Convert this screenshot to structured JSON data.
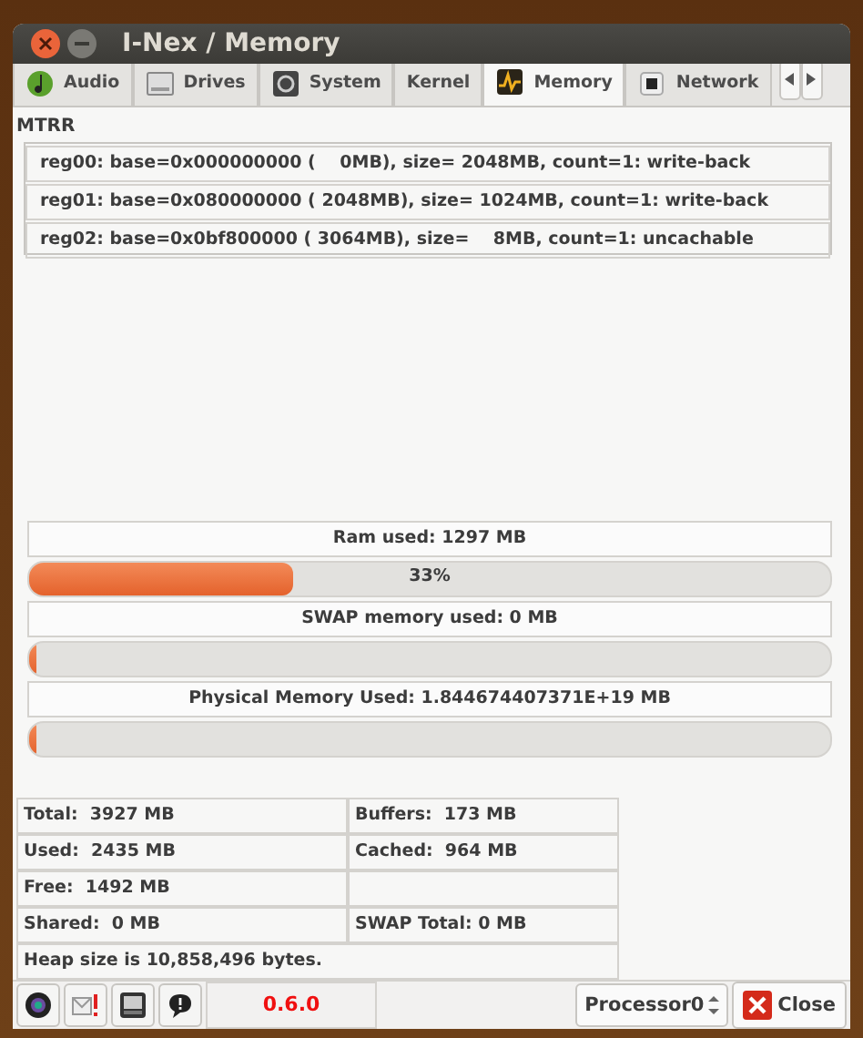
{
  "window": {
    "title": "I-Nex / Memory"
  },
  "tabs": [
    {
      "label": "Audio",
      "selected": false
    },
    {
      "label": "Drives",
      "selected": false
    },
    {
      "label": "System",
      "selected": false
    },
    {
      "label": "Kernel",
      "selected": false
    },
    {
      "label": "Memory",
      "selected": true
    },
    {
      "label": "Network",
      "selected": false
    }
  ],
  "mtrr": {
    "title": "MTRR",
    "rows": [
      "reg00: base=0x000000000 (    0MB), size= 2048MB, count=1: write-back",
      "reg01: base=0x080000000 ( 2048MB), size= 1024MB, count=1: write-back",
      "reg02: base=0x0bf800000 ( 3064MB), size=    8MB, count=1: uncachable"
    ]
  },
  "meters": [
    {
      "label": "Ram used: 1297 MB",
      "level": 0.33,
      "reading": "33%"
    },
    {
      "label": "SWAP memory used: 0 MB",
      "level": 0.01
    },
    {
      "label": "Physical Memory Used: 1.844674407371E+19 MB",
      "level": 0.01
    }
  ],
  "stats": [
    {
      "left": "Total:  3927 MB",
      "right": "Buffers:  173 MB"
    },
    {
      "left": "Used:  2435 MB",
      "right": "Cached:  964 MB"
    },
    {
      "left": "Free:  1492 MB"
    },
    {
      "left": "Shared:  0 MB",
      "right": "SWAP Total: 0 MB"
    }
  ],
  "heap": "Heap size is 10,858,496 bytes.",
  "footer": {
    "version": "0.6.0",
    "processor": "Processor0",
    "close": "Close"
  }
}
